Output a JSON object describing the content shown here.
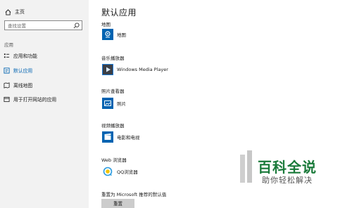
{
  "sidebar": {
    "home_label": "主页",
    "search_placeholder": "查找设置",
    "section_label": "应用",
    "items": [
      {
        "label": "应用和功能"
      },
      {
        "label": "默认应用"
      },
      {
        "label": "离线地图"
      },
      {
        "label": "用于打开网站的应用"
      }
    ]
  },
  "main": {
    "title": "默认应用",
    "categories": [
      {
        "label": "地图",
        "app": "地图"
      },
      {
        "label": "音乐播放器",
        "app": "Windows Media Player"
      },
      {
        "label": "照片查看器",
        "app": "照片"
      },
      {
        "label": "视频播放器",
        "app": "电影和电视"
      },
      {
        "label": "Web 浏览器",
        "app": "QQ浏览器"
      }
    ],
    "reset_label": "重置为 Microsoft 推荐的默认值",
    "reset_button": "重置"
  },
  "watermark": {
    "title": "百科全说",
    "subtitle": "助你轻松解决"
  },
  "colors": {
    "accent": "#0063b1",
    "sidebar_bg": "#f2f2f2",
    "watermark_green": "#1a7a3a"
  }
}
